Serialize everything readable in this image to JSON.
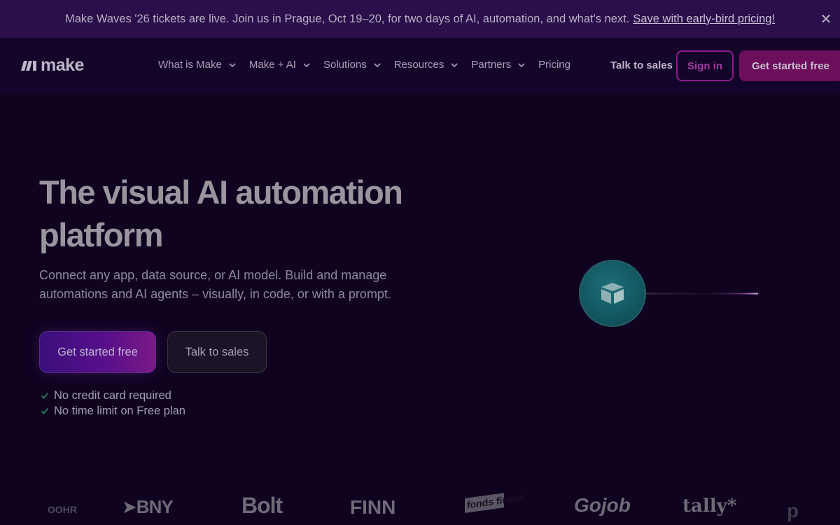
{
  "banner": {
    "text": "Make Waves '26 tickets are live. Join us in Prague, Oct 19–20, for two days of AI, automation, and what's next.",
    "link": "Save with early-bird pricing!",
    "close_icon": "close-icon"
  },
  "nav": {
    "logo_text": "make",
    "menu": [
      {
        "label": "What is Make",
        "has_dropdown": true
      },
      {
        "label": "Make + AI",
        "has_dropdown": true
      },
      {
        "label": "Solutions",
        "has_dropdown": true
      },
      {
        "label": "Resources",
        "has_dropdown": true
      },
      {
        "label": "Partners",
        "has_dropdown": true
      },
      {
        "label": "Pricing",
        "has_dropdown": false
      }
    ],
    "talk_to_sales": "Talk to sales",
    "sign_in": "Sign in",
    "get_started": "Get started free"
  },
  "hero": {
    "title_line1": "The visual AI automation",
    "title_line2": "platform",
    "subtitle_line1": "Connect any app, data source, or AI model. Build and manage",
    "subtitle_line2": "automations and AI agents – visually, in code, or with a prompt.",
    "primary_button": "Get started free",
    "secondary_button": "Talk to sales",
    "checks": [
      "No credit card required",
      "No time limit on Free plan"
    ]
  },
  "illustration": {
    "node_icon": "airtable-icon"
  },
  "logos": [
    "OOHR",
    "BNY",
    "Bolt",
    "FINN",
    "fonds finanz",
    "Gojob",
    "tally*",
    "p"
  ],
  "colors": {
    "background": "#0f0320",
    "banner": "#2a0f4a",
    "accent_magenta": "#6b0e5c",
    "accent_purple": "#3a0f7d",
    "node_teal": "#1d6f78"
  }
}
